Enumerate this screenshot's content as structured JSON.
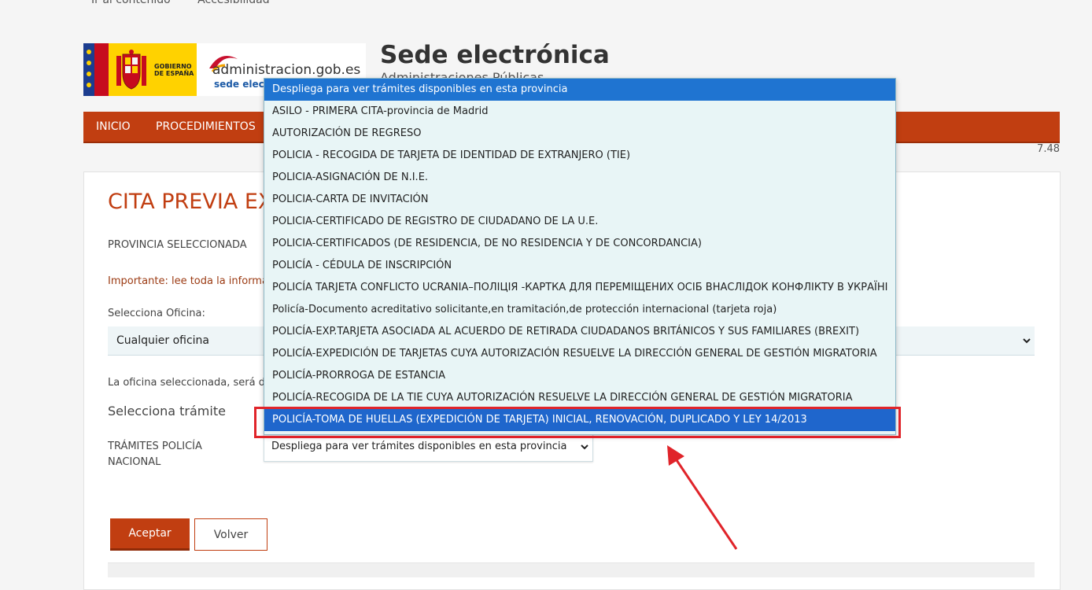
{
  "skip_links": [
    "Ir al contenido",
    "Accesibilidad"
  ],
  "header": {
    "gov_logo_text": [
      "GOBIERNO",
      "DE ESPAÑA"
    ],
    "admin_logo_text": "administracion.gob.es",
    "admin_logo_sub": "sede elect",
    "site_title": "Sede electrónica",
    "site_subtitle": "Administraciones Públicas"
  },
  "nav": {
    "items": [
      "INICIO",
      "PROCEDIMIENTOS"
    ]
  },
  "version": "7.48",
  "page": {
    "title": "CITA PREVIA EX",
    "provincia_label": "PROVINCIA SELECCIONADA",
    "important_text": "Importante: lee toda la informa",
    "oficina_label": "Selecciona Oficina:",
    "oficina_value": "Cualquier oficina",
    "oficina_note": "La oficina seleccionada, será d",
    "tramite_heading": "Selecciona trámite",
    "tramites_label_1": "TRÁMITES POLICÍA",
    "tramites_label_2": "NACIONAL",
    "tramite_value": "Despliega para ver trámites disponibles en esta provincia",
    "accept_label": "Aceptar",
    "back_label": "Volver"
  },
  "dropdown": {
    "options": [
      "Despliega para ver trámites disponibles en esta provincia",
      "ASILO - PRIMERA CITA-provincia de Madrid",
      "AUTORIZACIÓN DE REGRESO",
      "POLICIA - RECOGIDA DE TARJETA DE IDENTIDAD DE EXTRANJERO (TIE)",
      "POLICIA-ASIGNACIÓN DE N.I.E.",
      "POLICIA-CARTA DE INVITACIÓN",
      "POLICIA-CERTIFICADO DE REGISTRO DE CIUDADANO DE LA U.E.",
      "POLICIA-CERTIFICADOS (DE RESIDENCIA, DE NO RESIDENCIA Y DE CONCORDANCIA)",
      "POLICÍA - CÉDULA DE INSCRIPCIÓN",
      "POLICÍA TARJETA CONFLICTO UCRANIA–ПОЛІЦІЯ -КАРТКА ДЛЯ ПЕРЕМІЩЕНИХ ОСІБ ВНАСЛІДОК КОНФЛІКТУ В УКРАЇНІ",
      "Policía-Documento acreditativo solicitante,en tramitación,de protección internacional (tarjeta roja)",
      "POLICÍA-EXP.TARJETA ASOCIADA AL ACUERDO DE RETIRADA CIUDADANOS BRITÁNICOS Y SUS FAMILIARES (BREXIT)",
      "POLICÍA-EXPEDICIÓN DE TARJETAS CUYA AUTORIZACIÓN RESUELVE LA DIRECCIÓN GENERAL DE GESTIÓN MIGRATORIA",
      "POLICÍA-PRORROGA DE ESTANCIA",
      "POLICÍA-RECOGIDA DE LA TIE CUYA AUTORIZACIÓN RESUELVE LA DIRECCIÓN GENERAL DE GESTIÓN MIGRATORIA",
      "POLICÍA-TOMA DE HUELLAS (EXPEDICIÓN DE TARJETA) INICIAL, RENOVACIÓN, DUPLICADO Y LEY 14/2013"
    ]
  },
  "colors": {
    "brand": "#c13e11",
    "highlight": "#1f74d1",
    "annotation": "#e0242a"
  },
  "icons": {
    "select_arrow": "chevron-down-icon"
  }
}
